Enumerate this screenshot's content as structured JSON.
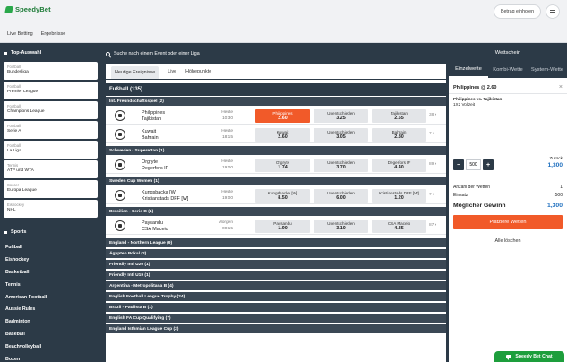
{
  "brand": {
    "name": "SpeedyBet",
    "color": "#2aa84a"
  },
  "header": {
    "login_label": "Betrag einholen",
    "menu_icon": "hamburger-icon"
  },
  "subnav": [
    "Live Betting",
    "Ergebnisse"
  ],
  "sidebar": {
    "top_title": "Top-Auswahl",
    "favorites": [
      {
        "cat": "Football",
        "name": "Bundesliga"
      },
      {
        "cat": "Football",
        "name": "Premier League"
      },
      {
        "cat": "Football",
        "name": "Champions League"
      },
      {
        "cat": "Football",
        "name": "Serie A"
      },
      {
        "cat": "Football",
        "name": "La Liga"
      },
      {
        "cat": "Tennis",
        "name": "ATP und WTA"
      },
      {
        "cat": "Soccer",
        "name": "Europa League"
      },
      {
        "cat": "Eishockey",
        "name": "NHL"
      }
    ],
    "sports_title": "Sports",
    "sports": [
      "Fußball",
      "Eishockey",
      "Basketball",
      "Tennis",
      "American Football",
      "Aussie Rules",
      "Badminton",
      "Baseball",
      "Beachvolleyball",
      "Boxen"
    ]
  },
  "search": {
    "placeholder": "Suche nach einem Event oder einer Liga"
  },
  "tabs": [
    "Heutige Ereignisse",
    "Live",
    "Höhepunkte"
  ],
  "main": {
    "sport_title": "Fußball (135)",
    "leagues": [
      {
        "name": "Int. Freundschaftsspiel (2)",
        "matches": [
          {
            "home": "Philippines",
            "away": "Tajikistan",
            "day": "Heute",
            "time": "10:30",
            "odds": [
              [
                "Philippines",
                "2.60"
              ],
              [
                "Unentschieden",
                "3.25"
              ],
              [
                "Tajikistan",
                "2.65"
              ]
            ],
            "more": "38",
            "selected": 0
          },
          {
            "home": "Kuwait",
            "away": "Bahrain",
            "day": "Heute",
            "time": "18:15",
            "odds": [
              [
                "Kuwait",
                "2.60"
              ],
              [
                "Unentschieden",
                "3.05"
              ],
              [
                "Bahrain",
                "2.80"
              ]
            ],
            "more": "7",
            "selected": -1
          }
        ]
      },
      {
        "name": "Schweden - Superettan (1)",
        "matches": [
          {
            "home": "Orgryte",
            "away": "Degerfors IF",
            "day": "Heute",
            "time": "19:00",
            "odds": [
              [
                "Orgryte",
                "1.74"
              ],
              [
                "Unentschieden",
                "3.70"
              ],
              [
                "Degerfors IF",
                "4.40"
              ]
            ],
            "more": "89",
            "selected": -1
          }
        ]
      },
      {
        "name": "Sweden Cup Women (1)",
        "matches": [
          {
            "home": "Kungsbacka [W]",
            "away": "Kristianstads DFF [W]",
            "day": "Heute",
            "time": "19:00",
            "odds": [
              [
                "Kungsbacka [W]",
                "8.50"
              ],
              [
                "Unentschieden",
                "6.00"
              ],
              [
                "Kristianstads DFF [W]",
                "1.20"
              ]
            ],
            "more": "7",
            "selected": -1
          }
        ]
      },
      {
        "name": "Brasilien - Serie B (1)",
        "matches": [
          {
            "home": "Paysandu",
            "away": "CSA Maceio",
            "day": "Morgen",
            "time": "00:15",
            "odds": [
              [
                "Paysandu",
                "1.90"
              ],
              [
                "Unentschieden",
                "3.10"
              ],
              [
                "CSA Maceio",
                "4.35"
              ]
            ],
            "more": "87",
            "selected": -1
          }
        ]
      }
    ],
    "collapsed_leagues": [
      "England - Northern League (9)",
      "Ägypten Pokal (2)",
      "Friendly Intl U20 (1)",
      "Friendly Intl U19 (1)",
      "Argentina - Metropolitana B (4)",
      "English Football League Trophy (24)",
      "Brazil - Paulista B (1)",
      "English FA Cup Qualifying (7)",
      "England Isthmian League Cup (2)"
    ]
  },
  "betslip": {
    "title": "Wettschein",
    "tabs": [
      "Einzelwette",
      "Kombi-Wette",
      "System-Wette"
    ],
    "pick": "Philippines @ 2.60",
    "match": "Philippines vs. Tajikistan",
    "market": "1X2 Vollzeit",
    "stake": "500",
    "return_label": "Zurück",
    "return_value": "1,300",
    "count_label": "Anzahl der Wetten",
    "count_value": "1",
    "stake_label": "Einsatz",
    "stake_value": "500",
    "win_label": "Möglicher Gewinn",
    "win_value": "1,300",
    "place_label": "Platziere Wetten",
    "clear_label": "Alle löschen"
  },
  "chat": {
    "label": "Speedy Bet Chat"
  },
  "colors": {
    "dark": "#2c3a47",
    "accent": "#f15a29",
    "blue": "#1e6fbf",
    "green": "#1d9e3c"
  }
}
